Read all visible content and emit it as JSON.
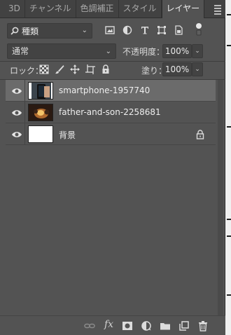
{
  "tabs": [
    {
      "label": "3D",
      "active": false
    },
    {
      "label": "チャンネル",
      "active": false
    },
    {
      "label": "色調補正",
      "active": false
    },
    {
      "label": "スタイル",
      "active": false
    },
    {
      "label": "レイヤー",
      "active": true
    }
  ],
  "filter": {
    "kind_label": "種類",
    "icons": [
      "pixel-filter-icon",
      "adjustment-filter-icon",
      "type-filter-icon",
      "shape-filter-icon",
      "smart-object-filter-icon",
      "filter-toggle-icon"
    ]
  },
  "blend": {
    "mode": "通常",
    "opacity_label": "不透明度：",
    "opacity_value": "100%"
  },
  "lock": {
    "label": "ロック：",
    "fill_label": "塗り：",
    "fill_value": "100%"
  },
  "layers": [
    {
      "name": "smartphone-1957740",
      "selected": true,
      "visible": true,
      "locked": false
    },
    {
      "name": "father-and-son-2258681",
      "selected": false,
      "visible": true,
      "locked": false
    },
    {
      "name": "背景",
      "selected": false,
      "visible": true,
      "locked": true
    }
  ],
  "bottom": {
    "fx_label": "fx"
  },
  "colors": {
    "panel_bg": "#535353",
    "tab_bg": "#424242",
    "selected_layer": "#6b6b6b"
  }
}
